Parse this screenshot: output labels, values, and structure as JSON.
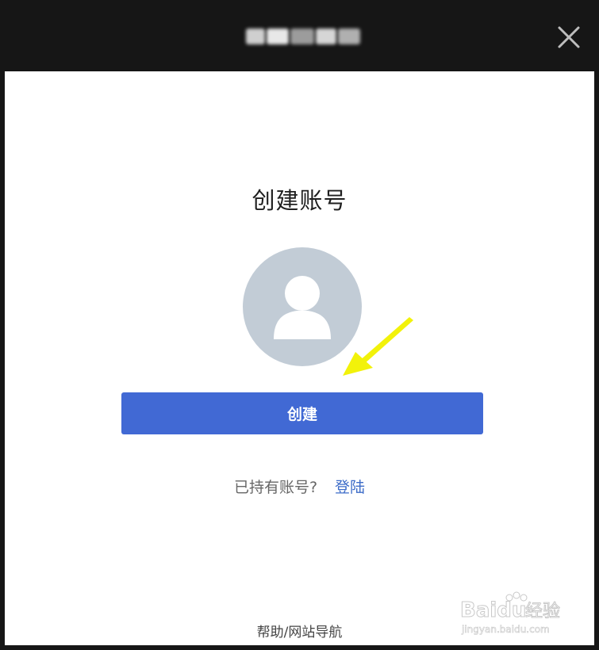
{
  "window": {
    "close_icon": "close-icon"
  },
  "dialog": {
    "title": "创建账号",
    "avatar_icon": "user-avatar-icon",
    "create_button_label": "创建",
    "have_account_text": "已持有账号?",
    "login_link_label": "登陆",
    "footer_link_label": "帮助/网站导航"
  },
  "colors": {
    "titlebar_bg": "#161616",
    "content_bg": "#ffffff",
    "primary_button": "#4169d4",
    "link": "#3d6cc8",
    "avatar_bg": "#c2ccd6",
    "annotation_arrow": "#f2f20a"
  },
  "watermark": {
    "brand": "Baidu",
    "brand_suffix": "经验",
    "url": "jingyan.baidu.com"
  }
}
